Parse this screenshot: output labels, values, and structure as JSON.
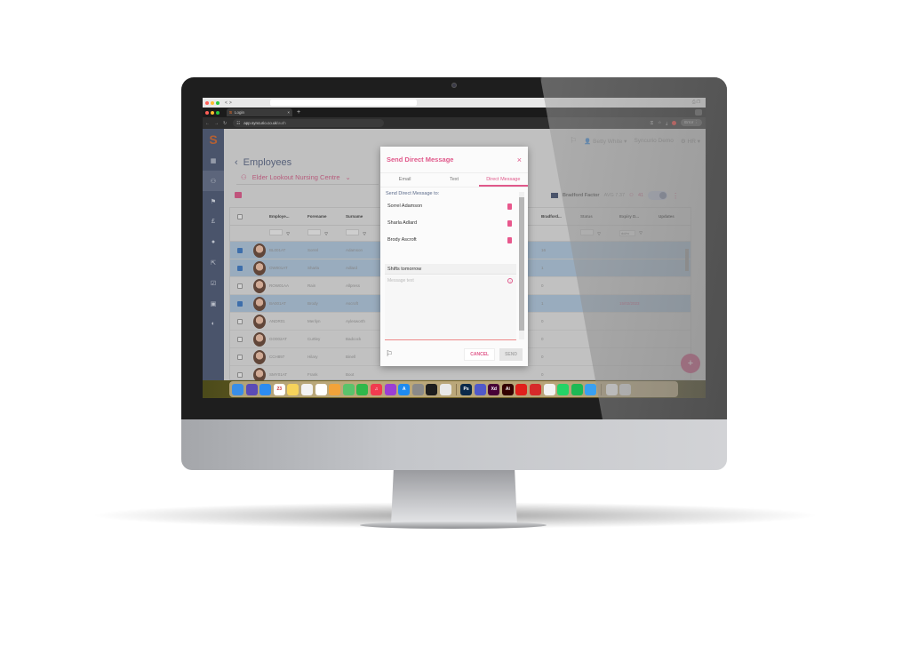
{
  "mac_window": {
    "controls": [
      "close",
      "minimize",
      "zoom"
    ],
    "nav": [
      "<",
      ">"
    ]
  },
  "browser": {
    "tab_title": "Login",
    "tab_favicon": "S",
    "new_tab": "+",
    "url_host": "app.syncurio.co.uk",
    "url_path": "/auth",
    "error_pill": "Error"
  },
  "app": {
    "logo": "S",
    "sidebar": [
      {
        "icon": "dashboard-icon",
        "glyph": "▦",
        "active": false
      },
      {
        "icon": "employees-icon",
        "glyph": "👥",
        "active": true
      },
      {
        "icon": "absence-icon",
        "glyph": "⚑",
        "active": false
      },
      {
        "icon": "pound-icon",
        "glyph": "£",
        "active": false
      },
      {
        "icon": "training-icon",
        "glyph": "●",
        "active": false
      },
      {
        "icon": "arrow-icon",
        "glyph": "⇱",
        "active": false
      },
      {
        "icon": "checklist-icon",
        "glyph": "☑",
        "active": false
      },
      {
        "icon": "document-icon",
        "glyph": "▣",
        "active": false
      },
      {
        "icon": "reports-icon",
        "glyph": "◐",
        "active": false
      }
    ],
    "header": {
      "user": "Betty White",
      "company": "Syncurio Demo",
      "role": "HR"
    },
    "page_title": "Employees",
    "location": "Elder Lookout Nursing Centre",
    "bradford": {
      "label": "Bradford Factor",
      "avg": "AVG 7.37",
      "count": "41"
    },
    "grid": {
      "headers": {
        "employee": "Employe...",
        "forename": "Forename",
        "surname": "Surname",
        "bradford": "Bradford...",
        "status": "Status",
        "expiry": "Expiry D...",
        "updates": "Updates"
      },
      "date_filter_placeholder": "dd/m",
      "rows": [
        {
          "selected": true,
          "id": "BL001AT",
          "forename": "Sorrel",
          "surname": "Adamson",
          "bradford": "16",
          "expiry": ""
        },
        {
          "selected": true,
          "id": "OW001AT",
          "forename": "Sharla",
          "surname": "Adlard",
          "bradford": "1",
          "expiry": ""
        },
        {
          "selected": false,
          "id": "ROW01AA",
          "forename": "Rain",
          "surname": "Allpress",
          "bradford": "0",
          "expiry": ""
        },
        {
          "selected": true,
          "id": "BA001AT",
          "forename": "Brody",
          "surname": "Ascroft",
          "bradford": "1",
          "expiry": "15/02/2023"
        },
        {
          "selected": false,
          "id": "ANDR01",
          "forename": "Merilyn",
          "surname": "Aylesworth",
          "bradford": "0",
          "expiry": ""
        },
        {
          "selected": false,
          "id": "GO002AT",
          "forename": "Curtley",
          "surname": "Badcock",
          "bradford": "0",
          "expiry": ""
        },
        {
          "selected": false,
          "id": "CCH897",
          "forename": "Hilary",
          "surname": "Binell",
          "bradford": "0",
          "expiry": ""
        },
        {
          "selected": false,
          "id": "SMY01AT",
          "forename": "Frank",
          "surname": "Boot",
          "bradford": "0",
          "expiry": ""
        }
      ]
    },
    "fab": "+"
  },
  "modal": {
    "title": "Send Direct Message",
    "close": "×",
    "tabs": [
      {
        "label": "Email",
        "active": false
      },
      {
        "label": "Text",
        "active": false
      },
      {
        "label": "Direct Message",
        "active": true
      }
    ],
    "to_label": "Send Direct Message to:",
    "recipients": [
      "Sorrel Adamson",
      "Sharla Adlard",
      "Brody Ascroft"
    ],
    "subject_value": "Shifts tomorrow",
    "message_placeholder": "Message text",
    "cancel": "CANCEL",
    "send": "SEND"
  },
  "dock": {
    "apps": [
      {
        "name": "finder",
        "color": "#3a8ee6",
        "label": ""
      },
      {
        "name": "siri",
        "color": "#5b4bb5",
        "label": ""
      },
      {
        "name": "safari",
        "color": "#2d8cf0",
        "label": ""
      },
      {
        "name": "calendar",
        "color": "#ffffff",
        "label": "23"
      },
      {
        "name": "notes",
        "color": "#f6d35b",
        "label": ""
      },
      {
        "name": "freeform",
        "color": "#f2f2f2",
        "label": ""
      },
      {
        "name": "reminders",
        "color": "#ffffff",
        "label": ""
      },
      {
        "name": "photos",
        "color": "#f2a33a",
        "label": ""
      },
      {
        "name": "maps",
        "color": "#5ac36b",
        "label": ""
      },
      {
        "name": "numbers",
        "color": "#2fb84a",
        "label": ""
      },
      {
        "name": "music",
        "color": "#f03b4f",
        "label": "♫"
      },
      {
        "name": "podcasts",
        "color": "#9b3fd4",
        "label": ""
      },
      {
        "name": "app-store",
        "color": "#1f8bf0",
        "label": "A"
      },
      {
        "name": "settings",
        "color": "#8a8a8a",
        "label": ""
      },
      {
        "name": "figma",
        "color": "#1e1e1e",
        "label": ""
      },
      {
        "name": "chrome",
        "color": "#e8e8e8",
        "label": ""
      },
      {
        "name": "photoshop",
        "color": "#0b2a4a",
        "label": "Ps"
      },
      {
        "name": "teams",
        "color": "#5059c9",
        "label": ""
      },
      {
        "name": "xd",
        "color": "#470137",
        "label": "Xd"
      },
      {
        "name": "illustrator",
        "color": "#330000",
        "label": "Ai"
      },
      {
        "name": "acrobat",
        "color": "#e0201b",
        "label": ""
      },
      {
        "name": "app-red",
        "color": "#d62a2a",
        "label": ""
      },
      {
        "name": "microsoft",
        "color": "#f2f2f2",
        "label": ""
      },
      {
        "name": "whatsapp",
        "color": "#25d366",
        "label": ""
      },
      {
        "name": "spotify",
        "color": "#1db954",
        "label": ""
      },
      {
        "name": "mail",
        "color": "#3aa0f0",
        "label": ""
      },
      {
        "name": "document",
        "color": "#f2f2f2",
        "label": ""
      },
      {
        "name": "trash",
        "color": "#d8d8d8",
        "label": ""
      }
    ]
  }
}
